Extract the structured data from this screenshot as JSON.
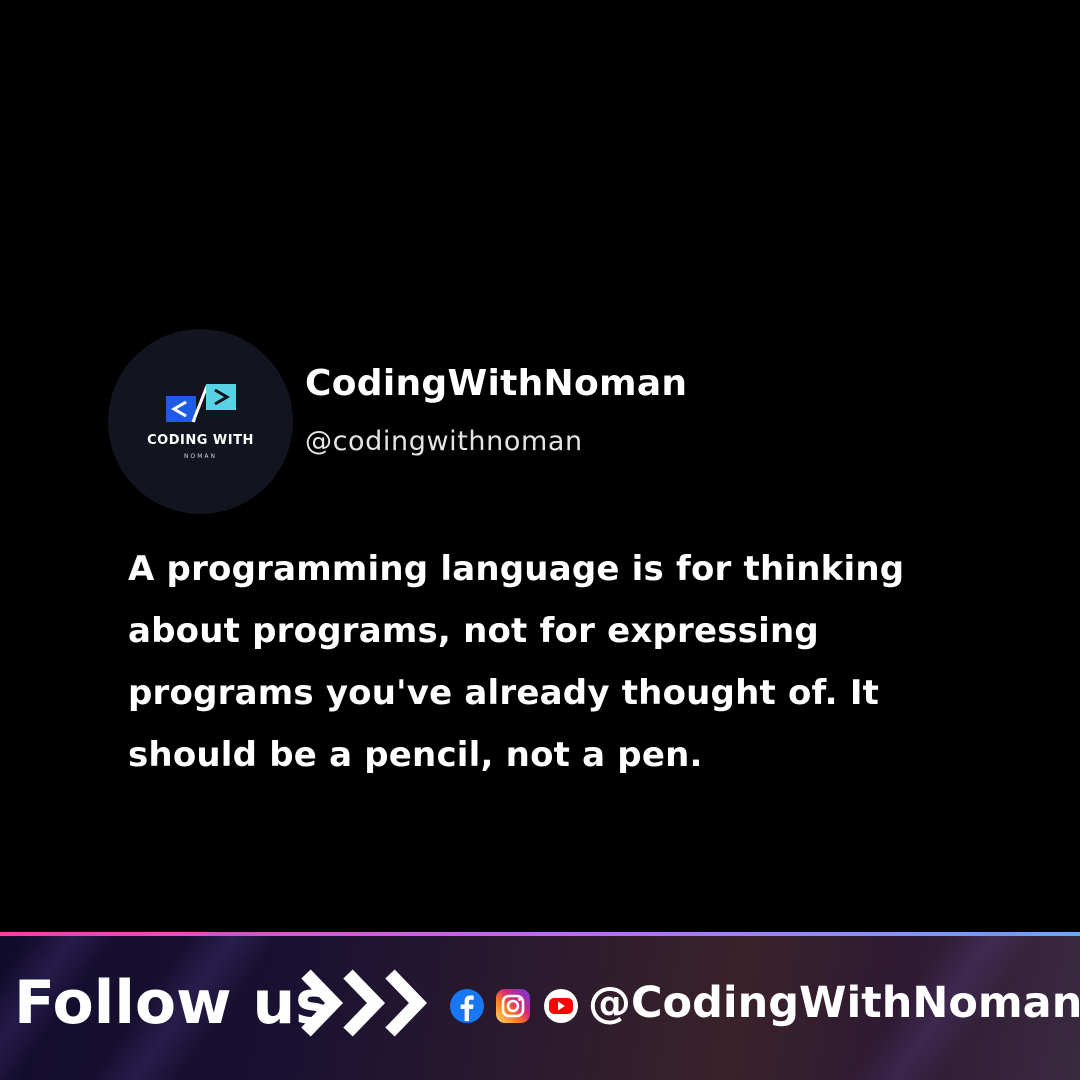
{
  "profile": {
    "logo_top": "CODING WITH",
    "logo_bottom": "NOMAN",
    "name": "CodingWithNoman",
    "handle": "@codingwithnoman"
  },
  "quote": "A programming language is for thinking about programs, not for expressing programs you've already thought of. It should be a pencil, not a pen.",
  "footer": {
    "follow_label": "Follow us",
    "arrows_icon": "triple-chevron-right-icon",
    "social_icons": [
      "facebook-icon",
      "instagram-icon",
      "youtube-icon"
    ],
    "handle": "@CodingWithNoman"
  },
  "colors": {
    "background": "#000000",
    "text": "#ffffff",
    "logo_blue": "#1f5ce6",
    "logo_cyan": "#5ad2e6",
    "facebook": "#1877f2",
    "youtube": "#ff0000"
  }
}
